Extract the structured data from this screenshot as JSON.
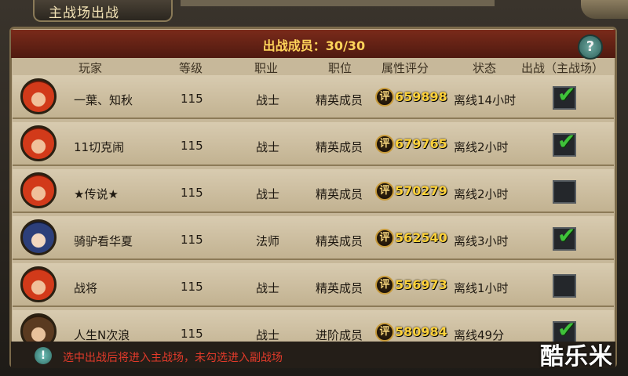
{
  "window": {
    "title": "主战场出战"
  },
  "header": {
    "members_label": "出战成员：30/30",
    "help_label": "?"
  },
  "columns": [
    "玩家",
    "等级",
    "职业",
    "职位",
    "属性评分",
    "状态",
    "出战（主战场）"
  ],
  "rows": [
    {
      "name": "一葉、知秋",
      "level": "115",
      "class": "战士",
      "rank": "精英成员",
      "score": "659898",
      "status": "离线14小时",
      "checked": true,
      "avatar": "av-red"
    },
    {
      "name": "11切克闹",
      "level": "115",
      "class": "战士",
      "rank": "精英成员",
      "score": "679765",
      "status": "离线2小时",
      "checked": true,
      "avatar": "av-red"
    },
    {
      "name": "★传说★",
      "level": "115",
      "class": "战士",
      "rank": "精英成员",
      "score": "570279",
      "status": "离线2小时",
      "checked": false,
      "avatar": "av-red"
    },
    {
      "name": "骑驴看华夏",
      "level": "115",
      "class": "法师",
      "rank": "精英成员",
      "score": "562540",
      "status": "离线3小时",
      "checked": true,
      "avatar": "av-blue"
    },
    {
      "name": "战将",
      "level": "115",
      "class": "战士",
      "rank": "精英成员",
      "score": "556973",
      "status": "离线1小时",
      "checked": false,
      "avatar": "av-red"
    },
    {
      "name": "人生N次浪",
      "level": "115",
      "class": "战士",
      "rank": "进阶成员",
      "score": "580984",
      "status": "离线49分",
      "checked": true,
      "avatar": "av-brown"
    }
  ],
  "score_badge": "评",
  "footer": {
    "info": "选中出战后将进入主战场，未勾选进入副战场",
    "info_icon": "!"
  },
  "watermark": "酷乐米",
  "colors": {
    "score": "#ffd23a",
    "check": "#3fc23a",
    "warning": "#e23a2a"
  }
}
